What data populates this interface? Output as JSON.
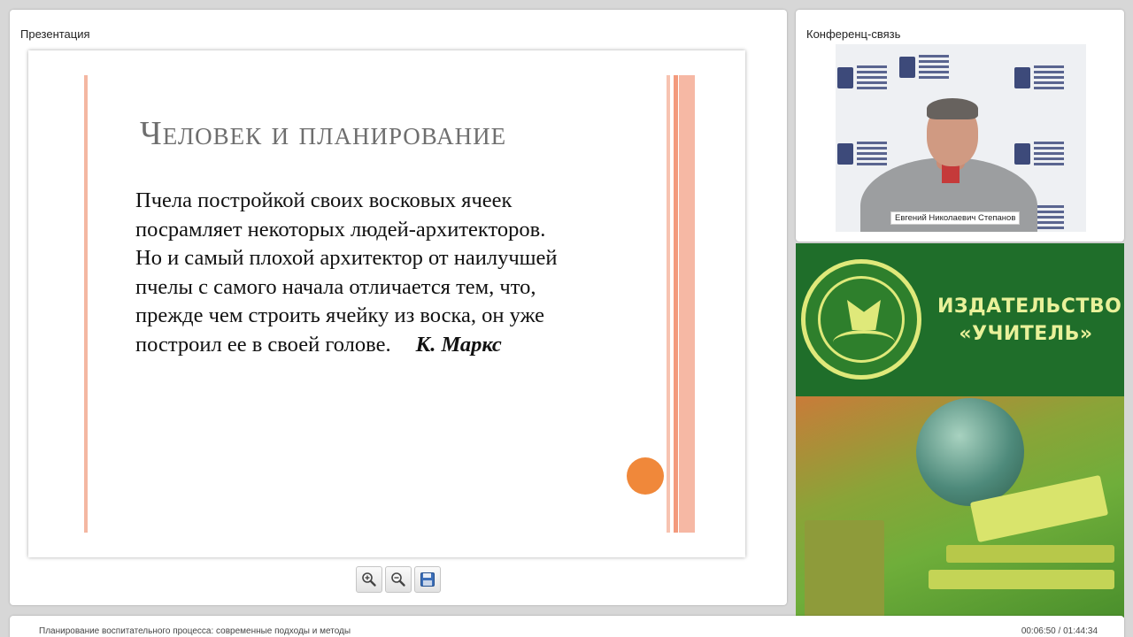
{
  "presentation": {
    "panel_title": "Презентация",
    "slide": {
      "title": "Человек и планирование",
      "quote_lines": [
        "Пчела постройкой своих восковых ячеек",
        "посрамляет некоторых людей-архитекторов.",
        "Но и самый плохой архитектор от наилучшей",
        "пчелы с самого начала отличается тем, что,",
        "прежде чем строить ячейку из воска, он уже",
        "построил ее в своей голове."
      ],
      "author": "К. Маркс"
    },
    "toolbar": {
      "zoom_in_icon": "zoom-in-icon",
      "zoom_out_icon": "zoom-out-icon",
      "save_icon": "floppy-disk-icon"
    }
  },
  "conference": {
    "panel_title": "Конференц-связь",
    "speaker_name": "Евгений Николаевич Степанов"
  },
  "banner": {
    "publisher_line1": "ИЗДАТЕЛЬСТВО",
    "publisher_line2": "«УЧИТЕЛЬ»"
  },
  "footer": {
    "lecture_title": "Планирование воспитательного процесса: современные подходы и методы",
    "time": "00:06:50 / 01:44:34"
  },
  "colors": {
    "accent_orange": "#f0883a",
    "rule_peach": "#f6b8a4",
    "banner_green": "#1f6e2a",
    "banner_text": "#e9f19a"
  }
}
